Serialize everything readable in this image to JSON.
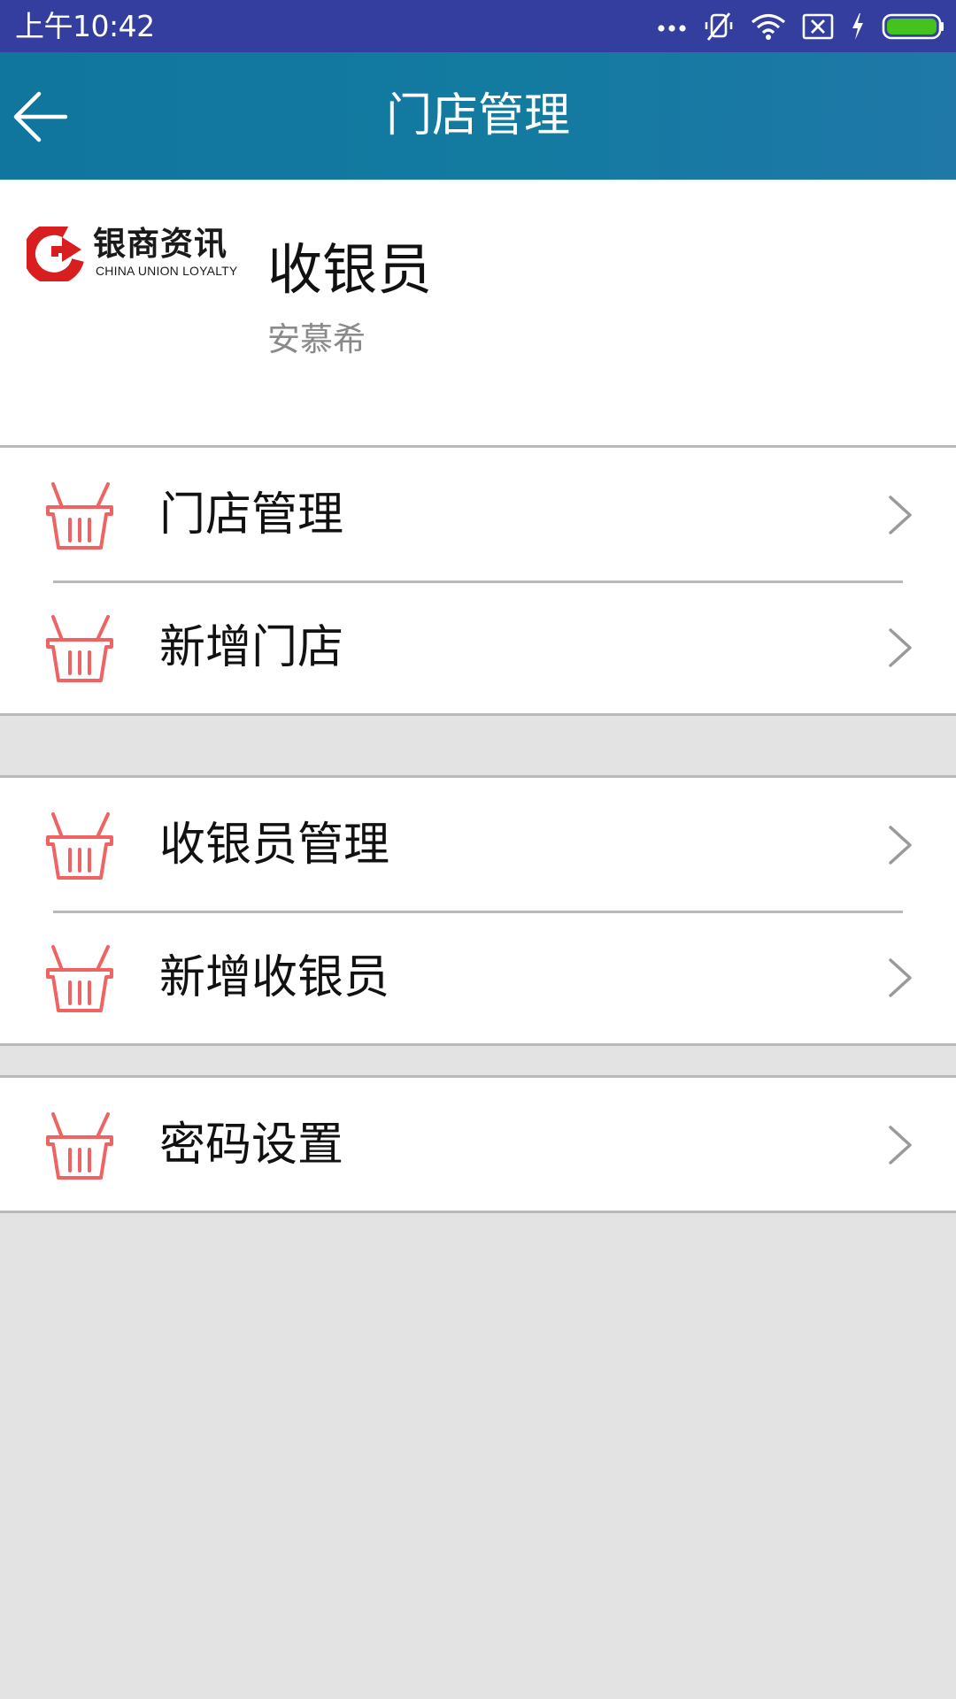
{
  "status_bar": {
    "time": "上午10:42",
    "icons": [
      "more-dots-icon",
      "vibrate-off-icon",
      "wifi-icon",
      "sim-x-icon",
      "charging-bolt-icon",
      "battery-icon"
    ],
    "battery_color": "#44c21e"
  },
  "app_bar": {
    "title": "门店管理",
    "back_icon": "back-arrow-icon",
    "color": "#137aa0"
  },
  "profile": {
    "logo_text_cn": "银商资讯",
    "logo_text_en": "CHINA UNION LOYALTY",
    "logo_color": "#d81e1e",
    "role": "收银员",
    "name": "安慕希"
  },
  "menu": {
    "icon": "basket-icon",
    "icon_color": "#ef6363",
    "groups": [
      {
        "items": [
          {
            "label": "门店管理"
          },
          {
            "label": "新增门店"
          }
        ]
      },
      {
        "items": [
          {
            "label": "收银员管理"
          },
          {
            "label": "新增收银员"
          }
        ]
      },
      {
        "items": [
          {
            "label": "密码设置"
          }
        ]
      }
    ]
  }
}
